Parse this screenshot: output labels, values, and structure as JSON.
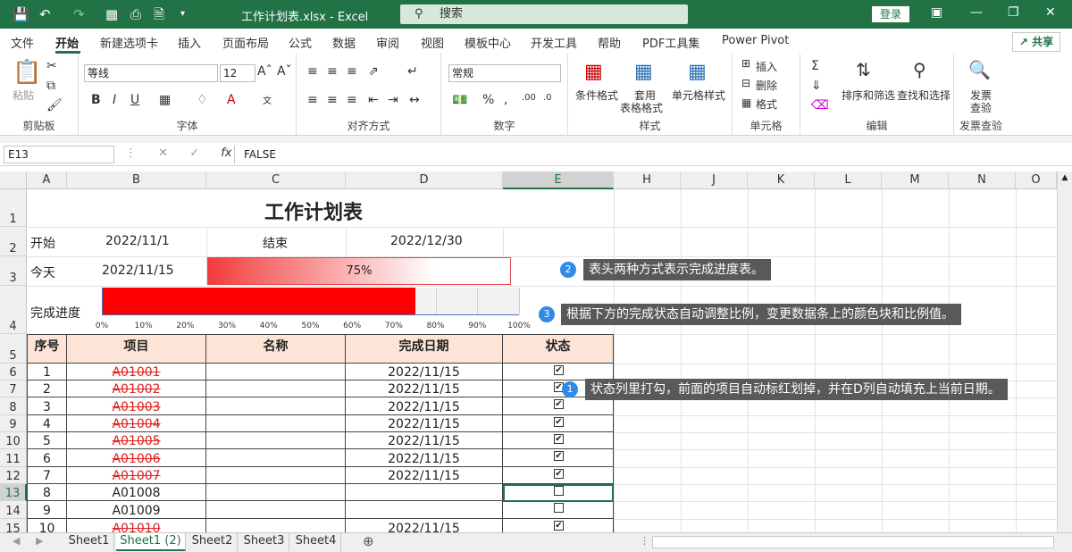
{
  "titlebar": {
    "title": "工作计划表.xlsx  -  Excel",
    "search_placeholder": "搜索",
    "login": "登录"
  },
  "menu": {
    "tabs": [
      "文件",
      "开始",
      "新建选项卡",
      "插入",
      "页面布局",
      "公式",
      "数据",
      "审阅",
      "视图",
      "模板中心",
      "开发工具",
      "帮助",
      "PDF工具集",
      "Power Pivot"
    ],
    "active": "开始",
    "share": "共享"
  },
  "ribbon": {
    "clipboard": {
      "label": "剪贴板",
      "paste": "粘贴"
    },
    "font": {
      "label": "字体",
      "font_name": "等线",
      "font_size": "12",
      "bold": "B",
      "italic": "I",
      "underline": "U"
    },
    "alignment": {
      "label": "对齐方式"
    },
    "number": {
      "label": "数字",
      "format": "常规"
    },
    "styles": {
      "label": "样式",
      "conditional": "条件格式",
      "table_fmt_1": "套用",
      "table_fmt_2": "表格格式",
      "cell_styles": "单元格样式"
    },
    "cells": {
      "label": "单元格",
      "insert": "插入",
      "delete": "删除",
      "format": "格式"
    },
    "editing": {
      "label": "编辑",
      "sort": "排序和筛选",
      "find": "查找和选择"
    },
    "invoice": {
      "label": "发票查验",
      "btn_1": "发票",
      "btn_2": "查验"
    }
  },
  "formula": {
    "namebox": "E13",
    "value": "FALSE",
    "fx": "fx"
  },
  "columns": [
    "A",
    "B",
    "C",
    "D",
    "E",
    "H",
    "J",
    "K",
    "L",
    "M",
    "N",
    "O"
  ],
  "rows": [
    "1",
    "2",
    "3",
    "4",
    "5",
    "6",
    "7",
    "8",
    "9",
    "10",
    "11",
    "12",
    "13",
    "14",
    "15"
  ],
  "sheet": {
    "title": "工作计划表",
    "start_label": "开始",
    "start_date": "2022/11/1",
    "end_label": "结束",
    "end_date": "2022/12/30",
    "today_label": "今天",
    "today_date": "2022/11/15",
    "progress_text": "75%",
    "progress_label": "完成进度",
    "progress_fraction": 0.75,
    "bar_ticks": [
      "0%",
      "10%",
      "20%",
      "30%",
      "40%",
      "50%",
      "60%",
      "70%",
      "80%",
      "90%",
      "100%"
    ],
    "table_headers": [
      "序号",
      "项目",
      "名称",
      "完成日期",
      "状态"
    ],
    "table_rows": [
      {
        "no": "1",
        "item": "A01001",
        "date": "2022/11/15",
        "done": true
      },
      {
        "no": "2",
        "item": "A01002",
        "date": "2022/11/15",
        "done": true
      },
      {
        "no": "3",
        "item": "A01003",
        "date": "2022/11/15",
        "done": true
      },
      {
        "no": "4",
        "item": "A01004",
        "date": "2022/11/15",
        "done": true
      },
      {
        "no": "5",
        "item": "A01005",
        "date": "2022/11/15",
        "done": true
      },
      {
        "no": "6",
        "item": "A01006",
        "date": "2022/11/15",
        "done": true
      },
      {
        "no": "7",
        "item": "A01007",
        "date": "2022/11/15",
        "done": true
      },
      {
        "no": "8",
        "item": "A01008",
        "date": "",
        "done": false
      },
      {
        "no": "9",
        "item": "A01009",
        "date": "",
        "done": false
      },
      {
        "no": "10",
        "item": "A01010",
        "date": "2022/11/15",
        "done": true
      }
    ]
  },
  "callouts": [
    {
      "num": "2",
      "text": "表头两种方式表示完成进度表。"
    },
    {
      "num": "3",
      "text": "根据下方的完成状态自动调整比例，变更数据条上的颜色块和比例值。"
    },
    {
      "num": "1",
      "text": "状态列里打勾，前面的项目自动标红划掉，并在D列自动填充上当前日期。"
    }
  ],
  "sheet_tabs": [
    "Sheet1",
    "Sheet1 (2)",
    "Sheet2",
    "Sheet3",
    "Sheet4"
  ],
  "active_sheet": "Sheet1 (2)",
  "colors": {
    "accent": "#217346",
    "bar_red": "#ff0000",
    "header_fill": "#fce4d6"
  }
}
